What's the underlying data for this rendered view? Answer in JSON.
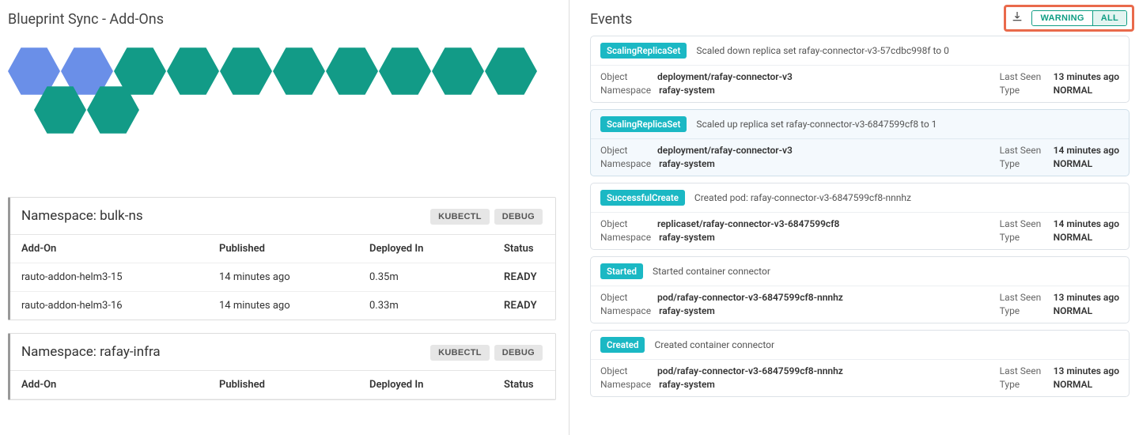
{
  "left": {
    "title": "Blueprint Sync - Add-Ons",
    "hex_row1_count": 10,
    "hex_blue_count": 2,
    "namespaces": [
      {
        "title": "Namespace: bulk-ns",
        "kubectl": "KUBECTL",
        "debug": "DEBUG",
        "headers": {
          "addon": "Add-On",
          "published": "Published",
          "deployed": "Deployed In",
          "status": "Status"
        },
        "rows": [
          {
            "addon": "rauto-addon-helm3-15",
            "published": "14 minutes ago",
            "deployed": "0.35m",
            "status": "READY"
          },
          {
            "addon": "rauto-addon-helm3-16",
            "published": "14 minutes ago",
            "deployed": "0.33m",
            "status": "READY"
          }
        ]
      },
      {
        "title": "Namespace: rafay-infra",
        "kubectl": "KUBECTL",
        "debug": "DEBUG",
        "headers": {
          "addon": "Add-On",
          "published": "Published",
          "deployed": "Deployed In",
          "status": "Status"
        },
        "rows": []
      }
    ]
  },
  "right": {
    "title": "Events",
    "filters": {
      "warning": "WARNING",
      "all": "ALL"
    },
    "meta_labels": {
      "object": "Object",
      "namespace": "Namespace",
      "last_seen": "Last Seen",
      "type": "Type"
    },
    "events": [
      {
        "badge": "ScalingReplicaSet",
        "msg": "Scaled down replica set rafay-connector-v3-57cdbc998f to 0",
        "object": "deployment/rafay-connector-v3",
        "namespace": "rafay-system",
        "last_seen": "13 minutes ago",
        "type": "NORMAL",
        "selected": false
      },
      {
        "badge": "ScalingReplicaSet",
        "msg": "Scaled up replica set rafay-connector-v3-6847599cf8 to 1",
        "object": "deployment/rafay-connector-v3",
        "namespace": "rafay-system",
        "last_seen": "14 minutes ago",
        "type": "NORMAL",
        "selected": true
      },
      {
        "badge": "SuccessfulCreate",
        "msg": "Created pod: rafay-connector-v3-6847599cf8-nnnhz",
        "object": "replicaset/rafay-connector-v3-6847599cf8",
        "namespace": "rafay-system",
        "last_seen": "14 minutes ago",
        "type": "NORMAL",
        "selected": false
      },
      {
        "badge": "Started",
        "msg": "Started container connector",
        "object": "pod/rafay-connector-v3-6847599cf8-nnnhz",
        "namespace": "rafay-system",
        "last_seen": "13 minutes ago",
        "type": "NORMAL",
        "selected": false
      },
      {
        "badge": "Created",
        "msg": "Created container connector",
        "object": "pod/rafay-connector-v3-6847599cf8-nnnhz",
        "namespace": "rafay-system",
        "last_seen": "13 minutes ago",
        "type": "NORMAL",
        "selected": false
      }
    ]
  }
}
